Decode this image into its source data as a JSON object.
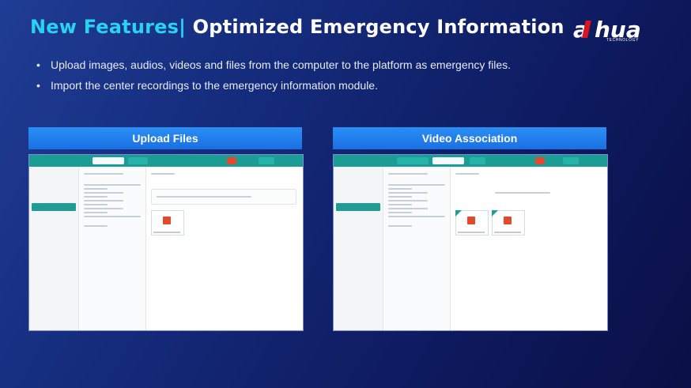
{
  "header": {
    "title_accent": "New Features|",
    "title_rest": " Optimized Emergency Information"
  },
  "brand": {
    "logo_text": "alhua",
    "logo_sub": "TECHNOLOGY"
  },
  "bullets": [
    "Upload images, audios, videos and files from the computer to the platform as emergency files.",
    "Import the center recordings to the emergency information module."
  ],
  "panels": [
    {
      "label": "Upload Files"
    },
    {
      "label": "Video Association"
    }
  ],
  "colors": {
    "accent": "#28d2f0",
    "panel": "#1a6fe3",
    "app_teal": "#1b9d96"
  }
}
